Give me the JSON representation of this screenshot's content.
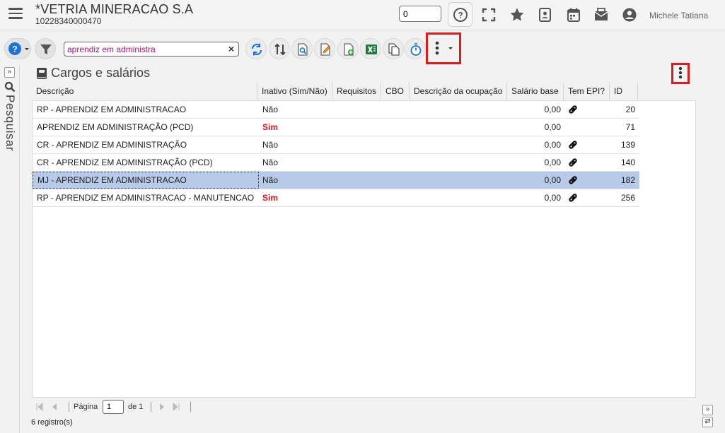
{
  "header": {
    "company_name": "*VETRIA MINERACAO S.A",
    "company_id": "10228340000470",
    "counter_value": "0",
    "user_name": "Michele Tatiana",
    "icons": [
      "help-circle-icon",
      "fullscreen-icon",
      "star-icon",
      "contact-card-icon",
      "calendar-icon",
      "mail-icon",
      "user-avatar-icon"
    ]
  },
  "toolbar": {
    "search_value": "aprendiz em administra",
    "clear_symbol": "×",
    "icons": [
      "help-icon",
      "filter-icon",
      "refresh-icon",
      "sort-icon",
      "preview-icon",
      "edit-icon",
      "new-icon",
      "excel-icon",
      "copy-icon",
      "timer-icon",
      "more-icon"
    ]
  },
  "sidebar": {
    "toggle": "»",
    "label": "Pesquisar"
  },
  "section": {
    "title": "Cargos e salários"
  },
  "grid": {
    "columns": [
      "Descrição",
      "Inativo (Sim/Não)",
      "Requisitos",
      "CBO",
      "Descrição da ocupação",
      "Salário base",
      "Tem EPI?",
      "ID"
    ],
    "rows": [
      {
        "descricao": "RP - APRENDIZ EM ADMINISTRACAO",
        "inativo": "Não",
        "salario": "0,00",
        "epi": true,
        "id": "20"
      },
      {
        "descricao": "APRENDIZ EM ADMINISTRAÇÃO (PCD)",
        "inativo": "Sim",
        "salario": "0,00",
        "epi": false,
        "id": "71"
      },
      {
        "descricao": "CR - APRENDIZ EM ADMINISTRAÇÃO",
        "inativo": "Não",
        "salario": "0,00",
        "epi": true,
        "id": "139"
      },
      {
        "descricao": "CR - APRENDIZ EM ADMINISTRAÇÃO (PCD)",
        "inativo": "Não",
        "salario": "0,00",
        "epi": true,
        "id": "140"
      },
      {
        "descricao": "MJ - APRENDIZ EM ADMINISTRACAO",
        "inativo": "Não",
        "salario": "0,00",
        "epi": true,
        "id": "182",
        "selected": true
      },
      {
        "descricao": "RP - APRENDIZ EM ADMINISTRACAO - MANUTENCAO",
        "inativo": "Sim",
        "salario": "0,00",
        "epi": true,
        "id": "256"
      }
    ]
  },
  "pager": {
    "page_label": "Página",
    "page_value": "1",
    "of_label": "de 1",
    "records": "6 registro(s)"
  },
  "colors": {
    "highlight_red": "#e01a1a",
    "selected_row": "#b7cbe9",
    "search_text": "#a0166e",
    "sim_red": "#e0101a"
  }
}
